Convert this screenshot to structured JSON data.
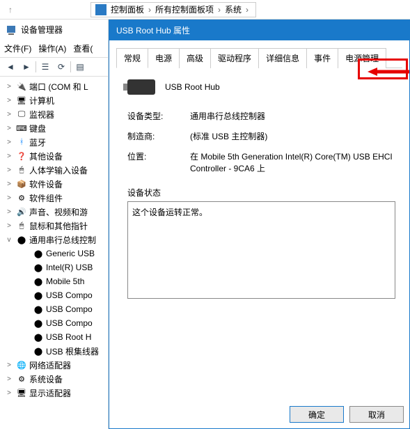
{
  "breadcrumb": {
    "items": [
      "控制面板",
      "所有控制面板项",
      "系统"
    ]
  },
  "device_manager": {
    "title": "设备管理器"
  },
  "menus": {
    "file": "文件(F)",
    "action": "操作(A)",
    "view": "查看("
  },
  "tree": [
    {
      "exp": ">",
      "icon": "port",
      "label": "端口 (COM 和 L"
    },
    {
      "exp": ">",
      "icon": "pc",
      "label": "计算机"
    },
    {
      "exp": ">",
      "icon": "monitor",
      "label": "监视器"
    },
    {
      "exp": ">",
      "icon": "keyboard",
      "label": "键盘"
    },
    {
      "exp": ">",
      "icon": "bt",
      "label": "蓝牙"
    },
    {
      "exp": ">",
      "icon": "other",
      "label": "其他设备"
    },
    {
      "exp": ">",
      "icon": "hid",
      "label": "人体学输入设备"
    },
    {
      "exp": ">",
      "icon": "sw",
      "label": "软件设备"
    },
    {
      "exp": ">",
      "icon": "comp",
      "label": "软件组件"
    },
    {
      "exp": ">",
      "icon": "audio",
      "label": "声音、视频和游"
    },
    {
      "exp": ">",
      "icon": "mouse",
      "label": "鼠标和其他指针"
    },
    {
      "exp": "v",
      "icon": "usb",
      "label": "通用串行总线控制"
    }
  ],
  "tree_children": [
    {
      "label": "Generic USB"
    },
    {
      "label": "Intel(R) USB"
    },
    {
      "label": "Mobile 5th"
    },
    {
      "label": "USB Compo"
    },
    {
      "label": "USB Compo"
    },
    {
      "label": "USB Compo"
    },
    {
      "label": "USB Root H"
    },
    {
      "label": "USB 根集线器"
    }
  ],
  "tree_tail": [
    {
      "exp": ">",
      "icon": "net",
      "label": "网络适配器"
    },
    {
      "exp": ">",
      "icon": "sys",
      "label": "系统设备"
    },
    {
      "exp": ">",
      "icon": "disp",
      "label": "显示适配器"
    }
  ],
  "dialog": {
    "title": "USB Root Hub 属性",
    "tabs": [
      "常规",
      "电源",
      "高级",
      "驱动程序",
      "详细信息",
      "事件",
      "电源管理"
    ],
    "active_tab": 0,
    "highlight_tab": 6,
    "device_name": "USB Root Hub",
    "rows": {
      "type_label": "设备类型:",
      "type_val": "通用串行总线控制器",
      "mfr_label": "制造商:",
      "mfr_val": "(标准 USB 主控制器)",
      "loc_label": "位置:",
      "loc_val": "在 Mobile 5th Generation Intel(R) Core(TM) USB EHCI Controller - 9CA6 上"
    },
    "status_label": "设备状态",
    "status_text": "这个设备运转正常。",
    "ok": "确定",
    "cancel": "取消"
  }
}
